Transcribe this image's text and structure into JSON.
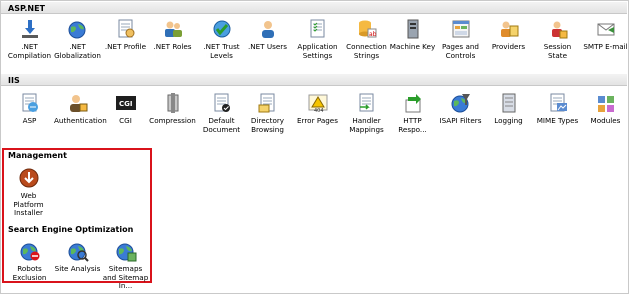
{
  "groups": {
    "aspnet": {
      "title": "ASP.NET",
      "items": [
        {
          "label": ".NET Compilation",
          "icon": "net-compilation-icon"
        },
        {
          "label": ".NET Globalization",
          "icon": "net-globalization-icon"
        },
        {
          "label": ".NET Profile",
          "icon": "net-profile-icon"
        },
        {
          "label": ".NET Roles",
          "icon": "net-roles-icon"
        },
        {
          "label": ".NET Trust Levels",
          "icon": "net-trust-levels-icon"
        },
        {
          "label": ".NET Users",
          "icon": "net-users-icon"
        },
        {
          "label": "Application Settings",
          "icon": "application-settings-icon"
        },
        {
          "label": "Connection Strings",
          "icon": "connection-strings-icon"
        },
        {
          "label": "Machine Key",
          "icon": "machine-key-icon"
        },
        {
          "label": "Pages and Controls",
          "icon": "pages-and-controls-icon"
        },
        {
          "label": "Providers",
          "icon": "providers-icon"
        },
        {
          "label": "Session State",
          "icon": "session-state-icon"
        },
        {
          "label": "SMTP E-mail",
          "icon": "smtp-email-icon"
        }
      ]
    },
    "iis": {
      "title": "IIS",
      "items": [
        {
          "label": "ASP",
          "icon": "asp-icon"
        },
        {
          "label": "Authentication",
          "icon": "authentication-icon"
        },
        {
          "label": "CGI",
          "icon": "cgi-icon"
        },
        {
          "label": "Compression",
          "icon": "compression-icon"
        },
        {
          "label": "Default Document",
          "icon": "default-document-icon"
        },
        {
          "label": "Directory Browsing",
          "icon": "directory-browsing-icon"
        },
        {
          "label": "Error Pages",
          "icon": "error-pages-icon"
        },
        {
          "label": "Handler Mappings",
          "icon": "handler-mappings-icon"
        },
        {
          "label": "HTTP Respo...",
          "icon": "http-response-headers-icon"
        },
        {
          "label": "ISAPI Filters",
          "icon": "isapi-filters-icon"
        },
        {
          "label": "Logging",
          "icon": "logging-icon"
        },
        {
          "label": "MIME Types",
          "icon": "mime-types-icon"
        },
        {
          "label": "Modules",
          "icon": "modules-icon"
        }
      ]
    },
    "management": {
      "title": "Management",
      "items": [
        {
          "label": "Web Platform Installer",
          "icon": "web-platform-installer-icon"
        }
      ]
    },
    "seo": {
      "title": "Search Engine Optimization",
      "items": [
        {
          "label": "Robots Exclusion",
          "icon": "robots-exclusion-icon"
        },
        {
          "label": "Site Analysis",
          "icon": "site-analysis-icon"
        },
        {
          "label": "Sitemaps and Sitemap In...",
          "icon": "sitemaps-icon"
        }
      ]
    }
  },
  "colors": {
    "highlight_border": "#d9131b",
    "header_bg": "#e8e8e8"
  }
}
